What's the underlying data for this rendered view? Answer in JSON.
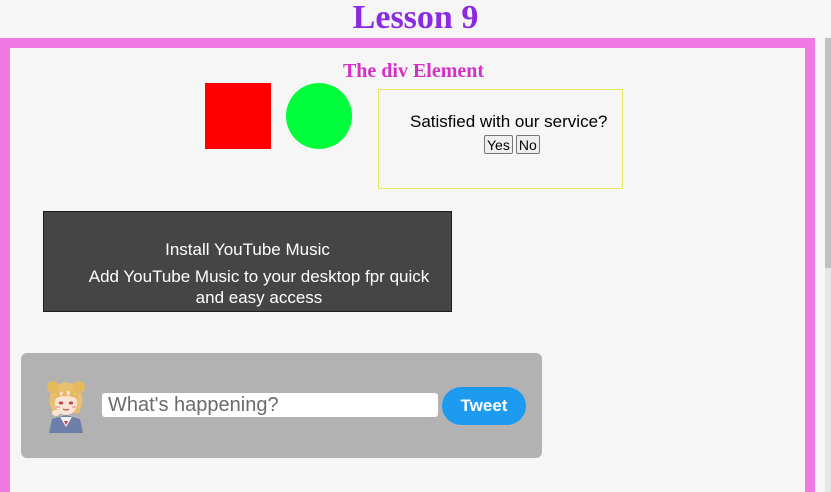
{
  "lesson_title": "Lesson 9",
  "div_heading": "The div Element",
  "survey": {
    "question": "Satisfied with our service?",
    "yes_label": "Yes",
    "no_label": "No"
  },
  "yt_card": {
    "title": "Install YouTube Music",
    "description": "Add YouTube Music to your desktop fpr quick and easy access"
  },
  "tweet": {
    "placeholder": "What's happening?",
    "button_label": "Tweet",
    "avatar_icon": "anime-avatar"
  },
  "colors": {
    "title": "#8a2be2",
    "frame_border": "#ef7ae4",
    "heading": "#d42fc6",
    "red_square": "#ff0000",
    "green_circle": "#00ff3a",
    "tweet_button": "#1d9bf0"
  }
}
